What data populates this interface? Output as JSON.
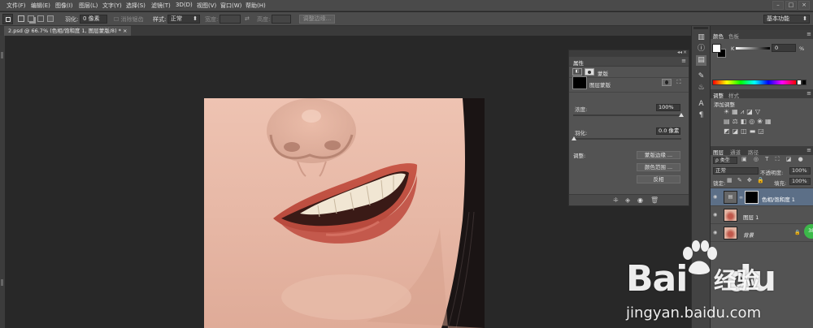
{
  "menu": [
    {
      "name": "file",
      "label": "文件(F)"
    },
    {
      "name": "edit",
      "label": "编辑(E)"
    },
    {
      "name": "image",
      "label": "图像(I)"
    },
    {
      "name": "layer",
      "label": "图层(L)"
    },
    {
      "name": "type",
      "label": "文字(Y)"
    },
    {
      "name": "select",
      "label": "选择(S)"
    },
    {
      "name": "filter",
      "label": "滤镜(T)"
    },
    {
      "name": "3d",
      "label": "3D(D)"
    },
    {
      "name": "view",
      "label": "视图(V)"
    },
    {
      "name": "window",
      "label": "窗口(W)"
    },
    {
      "name": "help",
      "label": "帮助(H)"
    }
  ],
  "options": {
    "feather_label": "羽化:",
    "feather_value": "0 像素",
    "antialias_label": "消除锯齿",
    "style_label": "样式:",
    "style_value": "正常",
    "width_label": "宽度:",
    "height_label": "高度:",
    "refine_edge": "调整边缘...",
    "workspace": "基本功能"
  },
  "document_tab": "2.psd @ 66.7% (色相/饱和度 1, 图层蒙版/8) * ×",
  "properties": {
    "title": "属性",
    "mask_label": "蒙版",
    "layer_mask": "图层蒙版",
    "density_label": "浓度:",
    "density_value": "100%",
    "density_fraction": 1.0,
    "feather_label": "羽化:",
    "feather_value": "0.0 像素",
    "adjust_label": "调整:",
    "btn_mask_edge": "蒙版边缘 ...",
    "btn_color_range": "颜色范围 ...",
    "btn_invert": "反相"
  },
  "color_panel": {
    "tab_color": "颜色",
    "tab_swatches": "色板",
    "k_label": "K",
    "k_value": "0",
    "k_unit": "%"
  },
  "adjustments_panel": {
    "tab_adjust": "调整",
    "tab_styles": "样式",
    "add_label": "添加调整"
  },
  "layers_panel": {
    "tab_layers": "图层",
    "tab_channels": "通道",
    "tab_paths": "路径",
    "filter_kind": "ρ 类型",
    "blend_mode": "正常",
    "opacity_label": "不透明度:",
    "opacity_value": "100%",
    "lock_label": "锁定:",
    "fill_label": "填充:",
    "fill_value": "100%",
    "layers": [
      {
        "name": "色相/饱和度 1",
        "selected": true
      },
      {
        "name": "图层 1",
        "selected": false
      },
      {
        "name": "背景",
        "selected": false
      }
    ]
  },
  "watermark": {
    "baidu": "Bai",
    "du": "du",
    "jingyan": "经验",
    "url": "jingyan.baidu.com"
  },
  "badge": "38"
}
